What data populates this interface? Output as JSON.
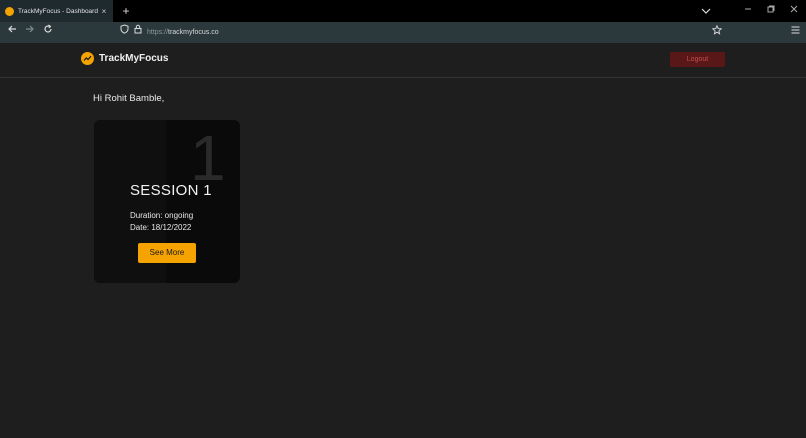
{
  "browser": {
    "tab_title": "TrackMyFocus - Dashboard",
    "tab_close": "×",
    "new_tab": "+",
    "url_scheme": "https://",
    "url_host": "trackmyfocus.co"
  },
  "header": {
    "brand_name": "TrackMyFocus",
    "logout_label": "Logout"
  },
  "main": {
    "greeting": "Hi Rohit Bamble,",
    "session_card": {
      "number": "1",
      "title": "SESSION 1",
      "duration": "Duration: ongoing",
      "date": "Date: 18/12/2022",
      "button_label": "See More"
    }
  },
  "colors": {
    "accent": "#f5a300",
    "logout_bg": "#5a1717",
    "page_bg": "#1e1e1e"
  },
  "icons": [
    "back-icon",
    "forward-icon",
    "reload-icon",
    "shield-icon",
    "lock-icon",
    "star-icon",
    "hamburger-menu-icon",
    "chevron-down-icon",
    "minimize-icon",
    "restore-icon",
    "close-window-icon"
  ]
}
